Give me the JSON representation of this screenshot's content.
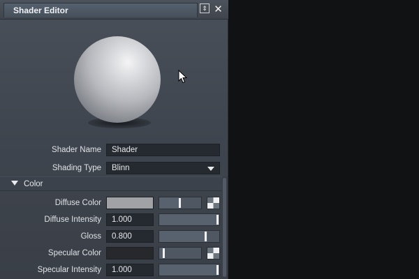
{
  "window": {
    "title": "Shader Editor",
    "pin_icon": "pin-icon",
    "close_icon": "close-icon",
    "close_glyph": "✕",
    "pin_glyph": "⇕"
  },
  "preview": {
    "sphere_icon": "material-preview-sphere",
    "cursor_icon": "mouse-cursor-icon"
  },
  "properties": {
    "shader_name": {
      "label": "Shader Name",
      "value": "Shader"
    },
    "shading_type": {
      "label": "Shading Type",
      "value": "Blinn",
      "icon": "dropdown-arrow-icon"
    }
  },
  "color_section": {
    "label": "Color",
    "icon": "collapse-arrow-icon",
    "rows": {
      "diffuse_color": {
        "label": "Diffuse Color",
        "swatch": "#a1a2a6",
        "slider_fraction": 0.5
      },
      "diffuse_intensity": {
        "label": "Diffuse Intensity",
        "value": "1.000",
        "slider_fraction": 1.0
      },
      "gloss": {
        "label": "Gloss",
        "value": "0.800",
        "slider_fraction": 0.8
      },
      "specular_color": {
        "label": "Specular Color",
        "swatch": "#26282c",
        "slider_fraction": 0.1
      },
      "specular_intensity": {
        "label": "Specular Intensity",
        "value": "1.000",
        "slider_fraction": 1.0
      }
    }
  }
}
